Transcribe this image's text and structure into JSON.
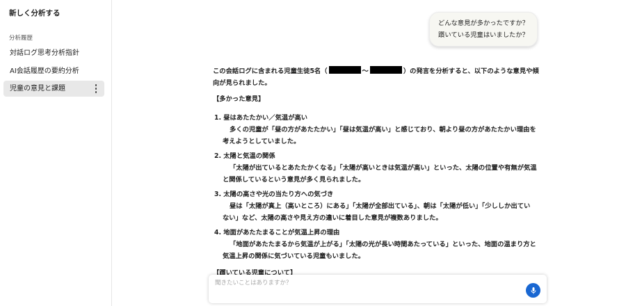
{
  "sidebar": {
    "new_analysis": "新しく分析する",
    "history_label": "分析履歴",
    "items": [
      {
        "label": "対話ログ思考分析指針"
      },
      {
        "label": "AI会話履歴の要約分析"
      },
      {
        "label": "児童の意見と課題",
        "selected": true
      }
    ]
  },
  "user_message": {
    "line1": "どんな意見が多かったですか？",
    "line2": "躓いている児童はいましたか？"
  },
  "answer": {
    "intro_a": "この会話ログに含まれる児童生徒5名（",
    "intro_sep": "～",
    "intro_b": "）の発言を分析すると、以下のような意見や傾",
    "intro_line2": "向が見られました。",
    "section_heading": "【多かった意見】",
    "points": [
      {
        "title": "1. 昼はあたたかい／気温が高い",
        "body_line1": "多くの児童が「昼の方があたたかい」「昼は気温が高い」と感じており、朝より昼の方があたたかい理由を",
        "body_line2": "考えようとしていました。"
      },
      {
        "title": "2. 太陽と気温の関係",
        "body_line1": "「太陽が出ているとあたたかくなる」「太陽が高いときは気温が高い」といった、太陽の位置や有無が気温",
        "body_line2": "と関係しているという意見が多く見られました。"
      },
      {
        "title": "3. 太陽の高さや光の当たり方への気づき",
        "body_line1": "昼は「太陽が真上（高いところ）にある」「太陽が全部出ている」、朝は「太陽が低い」「少ししか出てい",
        "body_line2": "ない」など、太陽の高さや見え方の違いに着目した意見が複数ありました。"
      },
      {
        "title": "4. 地面があたたまることが気温上昇の理由",
        "body_line1": "「地面があたたまるから気温が上がる」「太陽の光が長い時間あたっている」といった、地面の温まり方と",
        "body_line2": "気温上昇の関係に気づいている児童もいました。"
      }
    ],
    "partial_heading": "【躓いている児童について】"
  },
  "input": {
    "placeholder": "聞きたいことはありますか？",
    "value": "",
    "mic_icon": "microphone-icon"
  },
  "colors": {
    "accent": "#1967d2",
    "selected_item_bg": "#e8e8e8",
    "bubble_bg": "#f7f7f2"
  }
}
